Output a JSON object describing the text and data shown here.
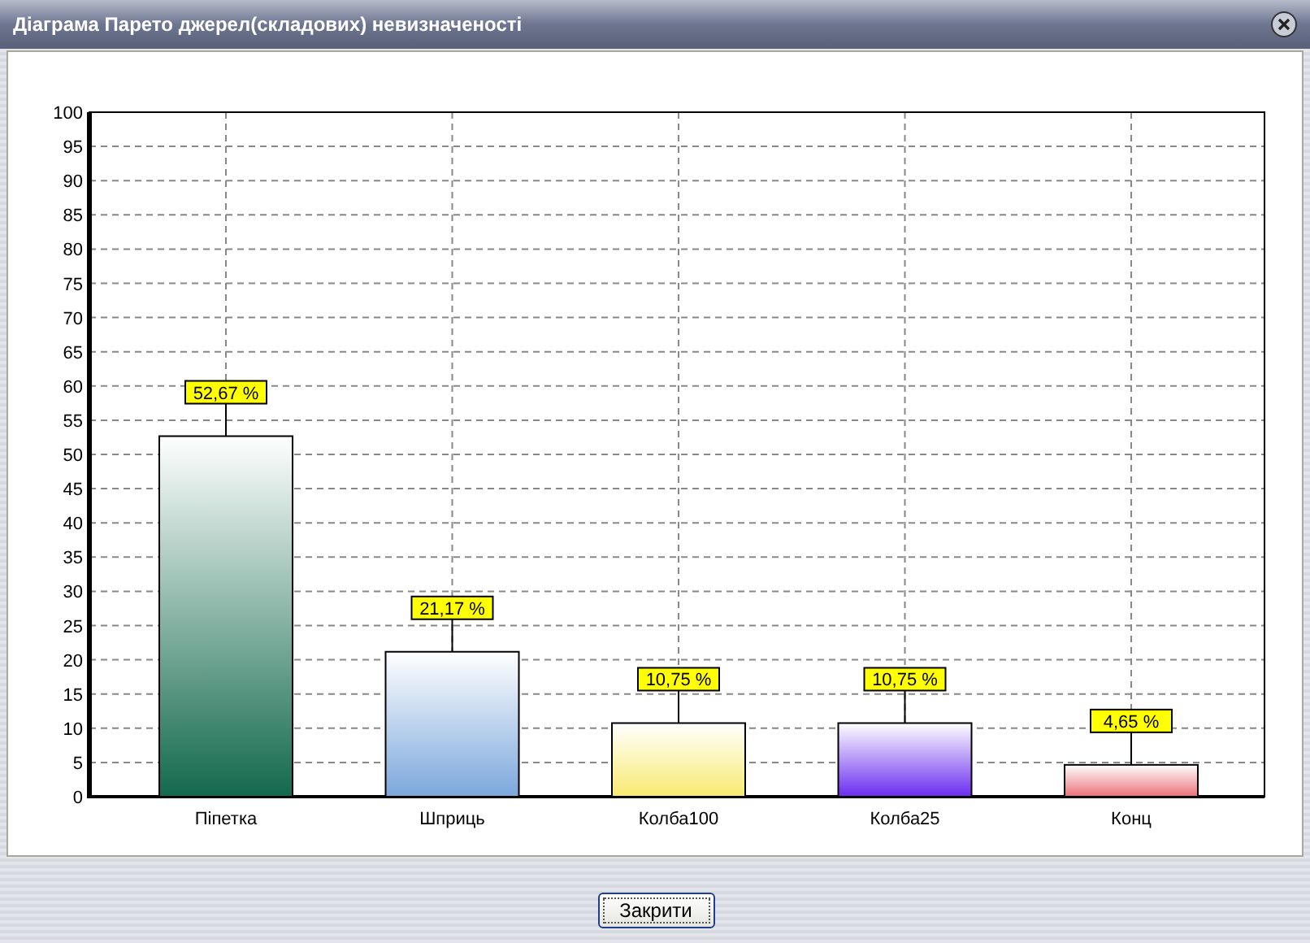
{
  "window": {
    "title": "Діаграма Парето джерел(складових) невизначеності"
  },
  "chart": {
    "chart_data": {
      "type": "bar",
      "categories": [
        "Піпетка",
        "Шприць",
        "Колба100",
        "Колба25",
        "Конц"
      ],
      "series": [
        {
          "values": [
            52.67,
            21.17,
            10.75,
            10.75,
            4.65
          ]
        }
      ],
      "grid": true,
      "colors": [
        "#13694d",
        "#7ba7dc",
        "#f8ea70",
        "#6a2cf0",
        "#e97078"
      ],
      "ylim": [
        0,
        100
      ],
      "yticks": [
        0,
        5,
        10,
        15,
        20,
        25,
        30,
        35,
        40,
        45,
        50,
        55,
        60,
        65,
        70,
        75,
        80,
        85,
        90,
        95,
        100
      ],
      "value_labels": [
        "52,67 %",
        "21,17 %",
        "10,75 %",
        "10,75 %",
        "4,65 %"
      ]
    }
  },
  "buttons": [
    {
      "label": "Закрити"
    }
  ]
}
